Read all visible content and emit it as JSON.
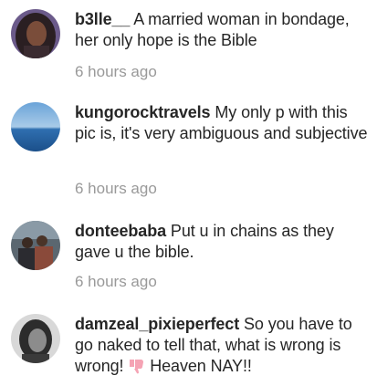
{
  "comments": [
    {
      "username": "b3lle__",
      "text": "A married woman in bondage, her only hope is the Bible",
      "time": "6 hours ago",
      "avatar": "woman-portrait"
    },
    {
      "username": "kungorocktravels",
      "text": "My only p with this pic is, it's very ambiguous and subjective",
      "time": "6 hours ago",
      "avatar": "sea-horizon"
    },
    {
      "username": "donteebaba",
      "text": "Put u in chains as they gave u the bible.",
      "time": "6 hours ago",
      "avatar": "group-photo"
    },
    {
      "username": "damzeal_pixieperfect",
      "text": "So you have to go naked to tell that, what is wrong is wrong!",
      "emoji": "thumbs-down-icon",
      "text_after_emoji": "Heaven NAY!!",
      "avatar": "woman-bw-portrait"
    }
  ],
  "colors": {
    "text": "#262626",
    "timestamp": "#999999",
    "emoji": "#f5a3b4"
  }
}
